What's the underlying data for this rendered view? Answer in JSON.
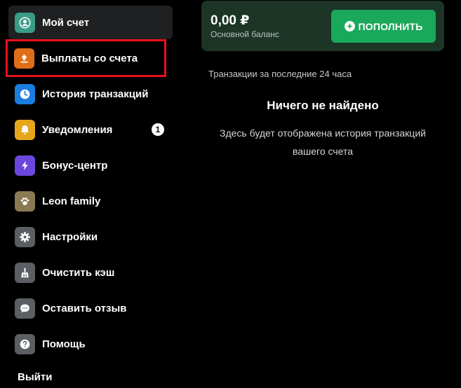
{
  "sidebar": {
    "items": [
      {
        "label": "Мой счет",
        "icon": "user-icon",
        "color": "#3a9b86"
      },
      {
        "label": "Выплаты со счета",
        "icon": "withdraw-upload-icon",
        "color": "#e06d17"
      },
      {
        "label": "История транзакций",
        "icon": "clock-icon",
        "color": "#1a7de0"
      },
      {
        "label": "Уведомления",
        "icon": "bell-icon",
        "color": "#e6a61b",
        "badge": "1"
      },
      {
        "label": "Бонус-центр",
        "icon": "lightning-icon",
        "color": "#6b47dd"
      },
      {
        "label": "Leon family",
        "icon": "paw-icon",
        "color": "#8a7a52"
      },
      {
        "label": "Настройки",
        "icon": "gear-icon",
        "color": "#5b5e63"
      },
      {
        "label": "Очистить кэш",
        "icon": "broom-icon",
        "color": "#5b5e63"
      },
      {
        "label": "Оставить отзыв",
        "icon": "chat-bubble-icon",
        "color": "#5b5e63"
      },
      {
        "label": "Помощь",
        "icon": "question-icon",
        "color": "#5b5e63"
      }
    ],
    "logout_label": "Выйти"
  },
  "balance": {
    "amount": "0,00 ₽",
    "label": "Основной баланс",
    "topup_label": "ПОПОЛНИТЬ"
  },
  "transactions": {
    "heading": "Транзакции за последние 24 часа",
    "empty_title": "Ничего не найдено",
    "empty_line1": "Здесь будет отображена история транзакций",
    "empty_line2": "вашего счета"
  },
  "colors": {
    "background": "#000000",
    "active_item": "#1f2022",
    "card": "#1c3527",
    "accent_green": "#1aa85a",
    "highlight_red": "#e8101a"
  }
}
